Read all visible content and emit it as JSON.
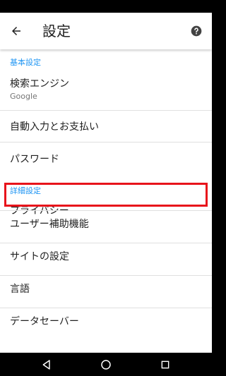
{
  "app_bar": {
    "title": "設定",
    "back_icon": "arrow-back-icon",
    "help_icon": "help-icon"
  },
  "sections": {
    "basic": {
      "header": "基本設定",
      "search_engine": {
        "label": "検索エンジン",
        "value": "Google"
      },
      "autofill": {
        "label": "自動入力とお支払い"
      },
      "passwords": {
        "label": "パスワード"
      }
    },
    "advanced": {
      "header": "詳細設定",
      "privacy": {
        "label": "プライバシー"
      },
      "accessibility": {
        "label": "ユーザー補助機能"
      },
      "site_settings": {
        "label": "サイトの設定"
      },
      "languages": {
        "label": "言語"
      },
      "data_saver": {
        "label": "データセーバー"
      }
    }
  },
  "colors": {
    "accent": "#2196f3",
    "highlight": "#e8131b"
  },
  "nav_bar": {
    "back_icon": "triangle-back-icon",
    "home_icon": "circle-home-icon",
    "recents_icon": "square-recents-icon"
  }
}
